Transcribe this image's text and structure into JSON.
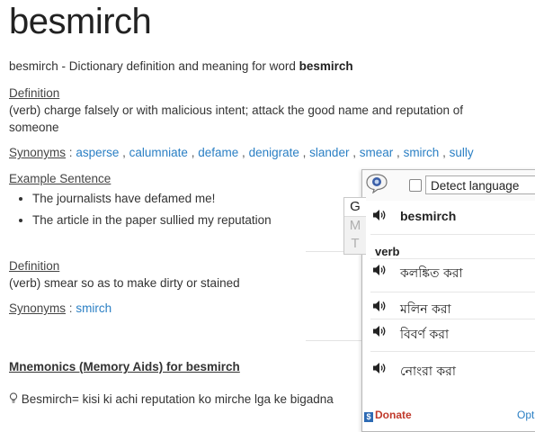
{
  "word": "besmirch",
  "intro": {
    "prefix": "besmirch - Dictionary definition and meaning for word ",
    "word_bold": "besmirch"
  },
  "definitions": [
    {
      "label": "Definition",
      "text": "(verb) charge falsely or with malicious intent; attack the good name and reputation of someone",
      "synonyms_label": "Synonyms",
      "synonyms": [
        "asperse",
        "calumniate",
        "defame",
        "denigrate",
        "slander",
        "smear",
        "smirch",
        "sully"
      ],
      "example_label": "Example Sentence",
      "examples": [
        "The journalists have defamed me!",
        "The article in the paper sullied my reputation"
      ]
    },
    {
      "label": "Definition",
      "text": "(verb) smear so as to make dirty or stained",
      "synonyms_label": "Synonyms",
      "synonyms": [
        "smirch"
      ]
    }
  ],
  "separator": ":",
  "syn_comma": ",",
  "mnemonics": {
    "heading": "Mnemonics (Memory Aids) for besmirch",
    "item": "Besmirch= kisi ki achi reputation ko mirche lga ke bigadna",
    "item_icon": "lightbulb-icon"
  },
  "translator": {
    "lang_select": "Detect language",
    "tabs": [
      "G",
      "M",
      "T"
    ],
    "source_word": "besmirch",
    "pos": "verb",
    "translations": [
      "কলঙ্কিত করা",
      "মলিন করা",
      "বিবর্ণ করা",
      "নোংরা করা"
    ],
    "donate": "Donate",
    "options": "Opt",
    "icons": [
      "translator-logo-icon",
      "speaker-icon",
      "checkbox-icon"
    ],
    "colors": {
      "link": "#2a7fc4",
      "donate": "#c0392b"
    }
  }
}
